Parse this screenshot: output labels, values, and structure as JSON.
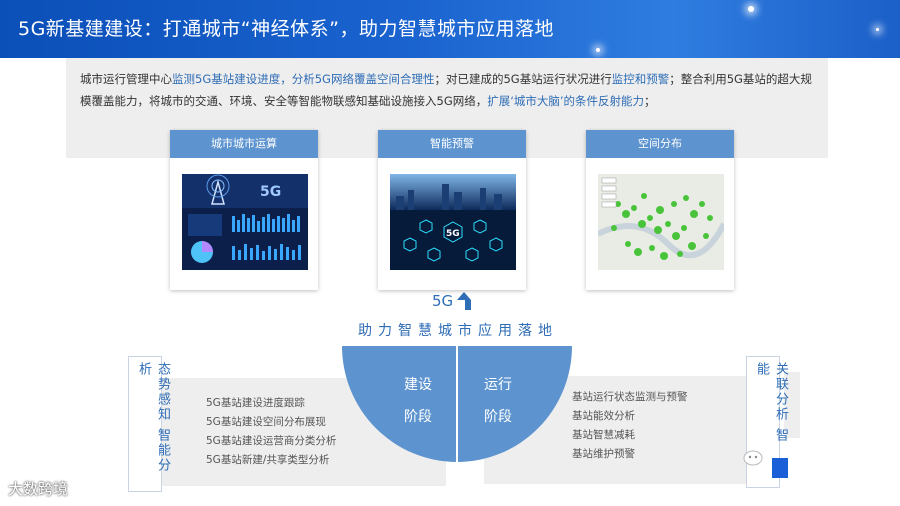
{
  "header": {
    "title": "5G新基建建设：打通城市“神经体系”，助力智慧城市应用落地"
  },
  "intro": {
    "p1": "城市运行管理中心",
    "p2": "监测5G基站建设进度，分析5G网络覆盖空间合理性",
    "p3": "；对已建成的5G基站运行状况进行",
    "p4": "监控和预警",
    "p5": "；整合利用",
    "p6": "5G基站的超大规模覆盖能力，将城市的交通、环境、安全等智能物联感知基础设施接入5G网络，",
    "p7": "扩展‘城市大脑’的条件反射",
    "p8": "能力",
    "p9": "；"
  },
  "cards": [
    {
      "label": "城市城市运算",
      "img_text": "5G"
    },
    {
      "label": "智能预警",
      "img_text": "5G"
    },
    {
      "label": "空间分布"
    }
  ],
  "center": {
    "up_label": "5G",
    "slogan": "助力智慧城市应用落地",
    "left_top": "建设",
    "left_bottom": "阶段",
    "right_top": "运行",
    "right_bottom": "阶段"
  },
  "left_side": {
    "label": "态势感知 智能分析"
  },
  "right_side": {
    "label": "关联分析 智能"
  },
  "left_list": [
    "5G基站建设进度跟踪",
    "5G基站建设空间分布展现",
    "5G基站建设运营商分类分析",
    "5G基站新建/共享类型分析"
  ],
  "right_list": [
    "基站运行状态监测与预警",
    "基站能效分析",
    "基站智慧减耗",
    "基站维护预警"
  ],
  "watermark": "大数跨境",
  "colors": {
    "brand": "#2f6db6",
    "card_header": "#5d94cf",
    "header_bg": "#1a63cf"
  }
}
